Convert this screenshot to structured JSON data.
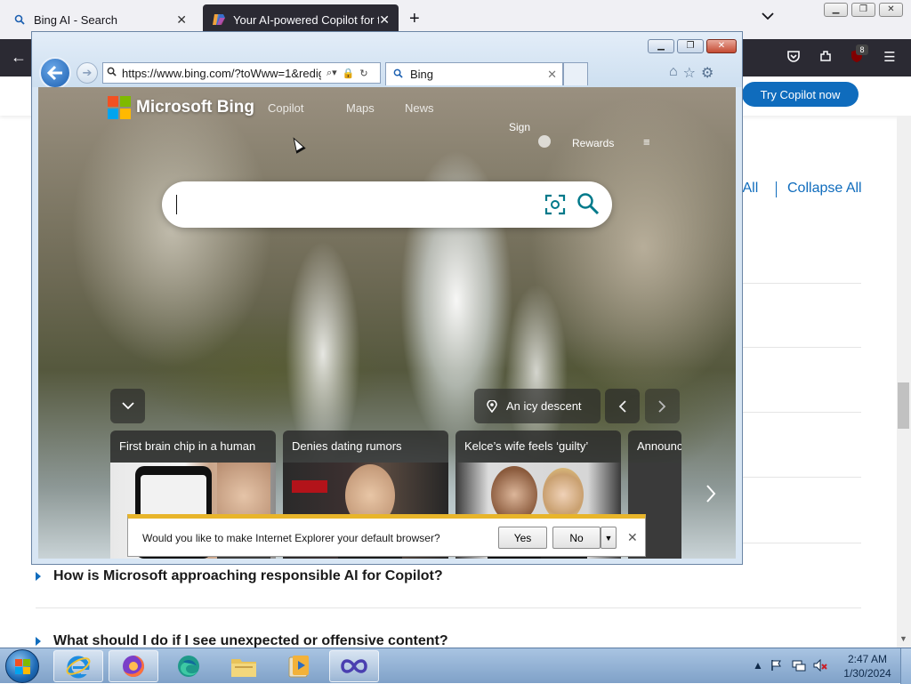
{
  "firefox": {
    "tabs": [
      {
        "label": "Bing AI - Search",
        "active": false
      },
      {
        "label": "Your AI-powered Copilot for the",
        "active": true
      }
    ],
    "extension_badge": "8",
    "try_copilot": "Try Copilot now",
    "expand_all": "d All",
    "collapse_all": "Collapse All",
    "faq": [
      "How is Microsoft approaching responsible AI for Copilot?",
      "What should I do if I see unexpected or offensive content?"
    ]
  },
  "ie": {
    "address": "https://www.bing.com/?toWww=1&redig",
    "tab_label": "Bing",
    "bing": {
      "logo": "Microsoft Bing",
      "nav": [
        "Copilot",
        "Maps",
        "News"
      ],
      "signin": "Sign",
      "rewards": "Rewards",
      "search_placeholder": "",
      "location_label": "An icy descent",
      "news": [
        "First brain chip in a human",
        "Denies dating rumors",
        "Kelce’s wife feels ‘guilty’",
        "Announc"
      ]
    },
    "notification": {
      "message": "Would you like to make Internet Explorer your default browser?",
      "yes": "Yes",
      "no": "No"
    }
  },
  "taskbar": {
    "time": "2:47 AM",
    "date": "1/30/2024"
  },
  "colors": {
    "copilot_blue": "#0f6cbd",
    "firefox_dark": "#2b2a33",
    "notif_stripe": "#e8b52a",
    "ms_red": "#f25022",
    "ms_green": "#7fba00",
    "ms_blue": "#00a4ef",
    "ms_yellow": "#ffb900"
  }
}
